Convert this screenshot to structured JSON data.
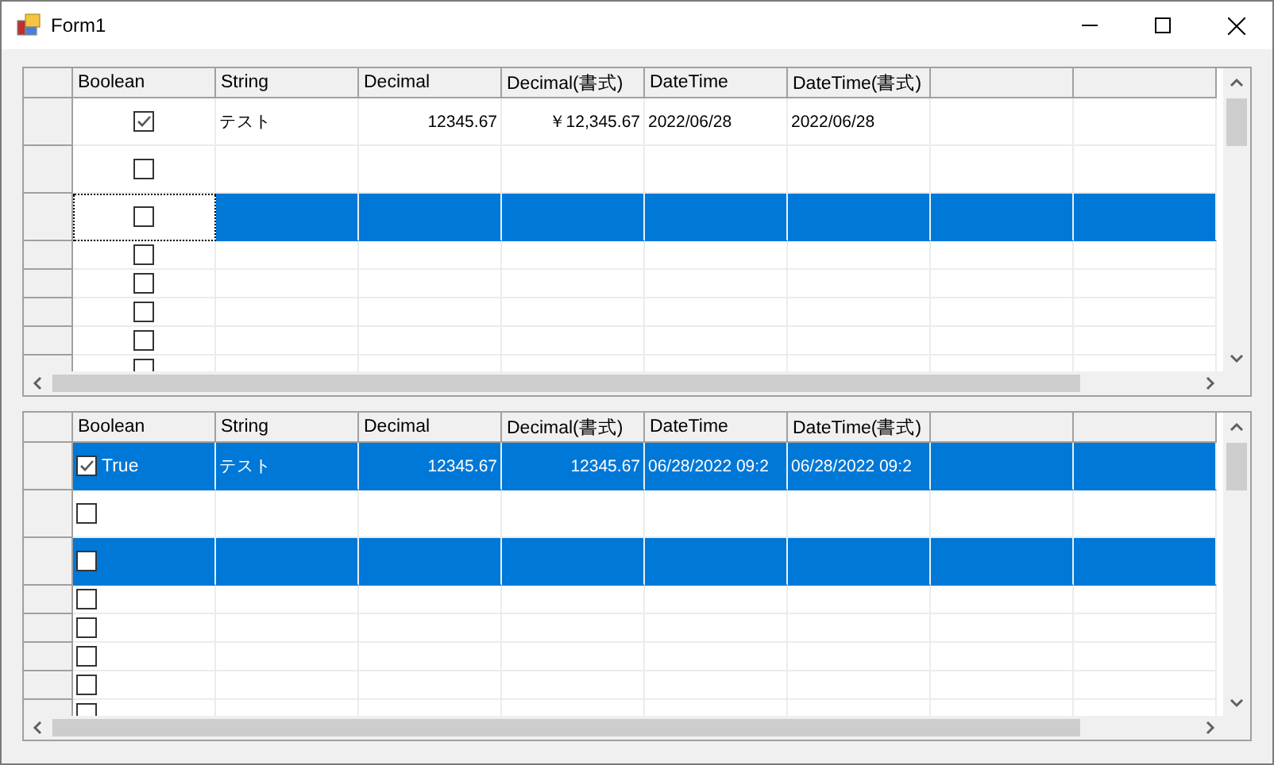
{
  "window": {
    "title": "Form1"
  },
  "grids": [
    {
      "kind": "checkbox",
      "columns": [
        {
          "label": "Boolean"
        },
        {
          "label": "String"
        },
        {
          "label": "Decimal"
        },
        {
          "label": "Decimal(書式)"
        },
        {
          "label": "DateTime"
        },
        {
          "label": "DateTime(書式)"
        }
      ],
      "rows": [
        {
          "selected": false,
          "current": false,
          "checked": true,
          "cells": [
            "テスト",
            "12345.67",
            "￥12,345.67",
            "2022/06/28",
            "2022/06/28"
          ]
        },
        {
          "selected": false,
          "current": false,
          "checked": false
        },
        {
          "selected": true,
          "current": true,
          "checked": false
        },
        {
          "selected": false,
          "current": false,
          "checked": false
        },
        {
          "selected": false,
          "current": false,
          "checked": false
        },
        {
          "selected": false,
          "current": false,
          "checked": false
        },
        {
          "selected": false,
          "current": false,
          "checked": false
        },
        {
          "selected": false,
          "current": false,
          "checked": false
        }
      ]
    },
    {
      "kind": "labeled",
      "columns": [
        {
          "label": "Boolean"
        },
        {
          "label": "String"
        },
        {
          "label": "Decimal"
        },
        {
          "label": "Decimal(書式)"
        },
        {
          "label": "DateTime"
        },
        {
          "label": "DateTime(書式)"
        }
      ],
      "rows": [
        {
          "selected": true,
          "current": false,
          "checked": true,
          "bool_text": "True",
          "cells": [
            "テスト",
            "12345.67",
            "12345.67",
            "06/28/2022 09:2",
            "06/28/2022 09:2"
          ]
        },
        {
          "selected": false,
          "current": false,
          "checked": false
        },
        {
          "selected": true,
          "current": false,
          "checked": false
        },
        {
          "selected": false,
          "current": false,
          "checked": false
        },
        {
          "selected": false,
          "current": false,
          "checked": false
        },
        {
          "selected": false,
          "current": false,
          "checked": false
        },
        {
          "selected": false,
          "current": false,
          "checked": false
        },
        {
          "selected": false,
          "current": false,
          "checked": false
        }
      ]
    }
  ]
}
